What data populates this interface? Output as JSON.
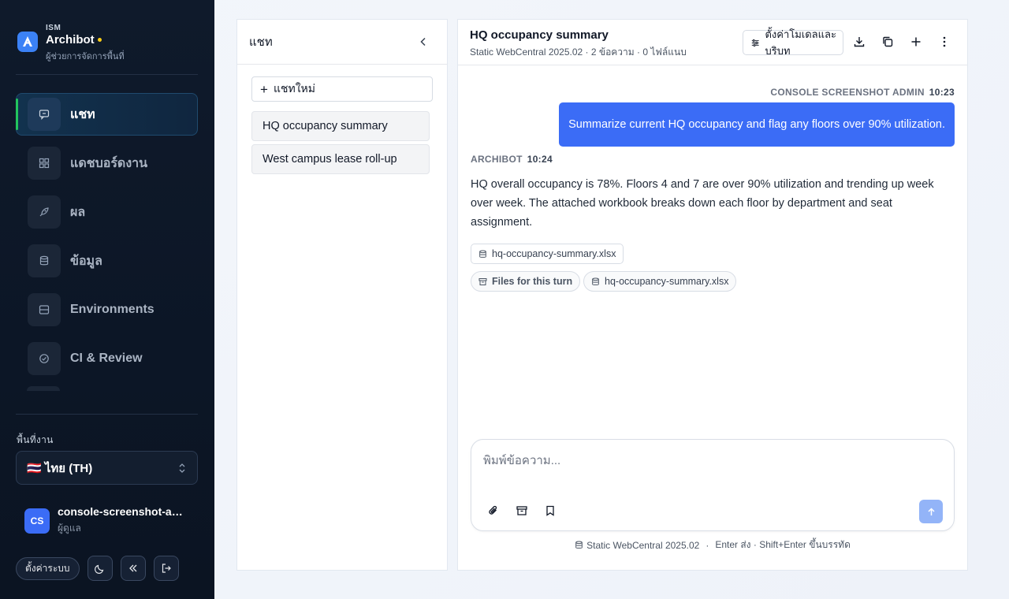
{
  "brand": {
    "small": "ISM",
    "name": "Archibot",
    "subtitle": "ผู้ช่วยการจัดการพื้นที่"
  },
  "sidebar": {
    "items": [
      {
        "label": "แชท",
        "icon": "chat-icon",
        "active": true
      },
      {
        "label": "แดชบอร์ดงาน",
        "icon": "dashboard-icon",
        "active": false
      },
      {
        "label": "ผล",
        "icon": "rocket-icon",
        "active": false
      },
      {
        "label": "ข้อมูล",
        "icon": "database-icon",
        "active": false
      },
      {
        "label": "Environments",
        "icon": "server-icon",
        "active": false
      },
      {
        "label": "CI & Review",
        "icon": "check-circle-icon",
        "active": false
      }
    ],
    "workspace_label": "พื้นที่งาน",
    "workspace_value": "🇹🇭 ไทย (TH)"
  },
  "user": {
    "initials": "CS",
    "name": "console-screenshot-admin",
    "role": "ผู้ดูแล"
  },
  "footer": {
    "settings_label": "ตั้งค่าระบบ"
  },
  "history": {
    "title": "แชท",
    "new_label": "แชทใหม่",
    "conversations": [
      "HQ occupancy summary",
      "West campus lease roll-up"
    ]
  },
  "chat": {
    "title": "HQ occupancy summary",
    "meta": "Static WebCentral 2025.02 · 2 ข้อความ · 0 ไฟล์แนบ",
    "config_label": "ตั้งค่าโมเดลและบริบท",
    "user_message": {
      "author": "CONSOLE SCREENSHOT ADMIN",
      "time": "10:23",
      "text": "Summarize current HQ occupancy and flag any floors over 90% utilization."
    },
    "bot_message": {
      "author": "ARCHIBOT",
      "time": "10:24",
      "text": "HQ overall occupancy is 78%. Floors 4 and 7 are over 90% utilization and trending up week over week. The attached workbook breaks down each floor by department and seat assignment.",
      "attachment": "hq-occupancy-summary.xlsx",
      "files_label": "Files for this turn",
      "files_item": "hq-occupancy-summary.xlsx"
    },
    "composer_placeholder": "พิมพ์ข้อความ...",
    "hint_env": "Static WebCentral 2025.02",
    "hint_keys": "Enter ส่ง · Shift+Enter ขึ้นบรรทัด"
  },
  "colors": {
    "accent": "#3b6cf6",
    "sidebar_bg": "#0f1a2b",
    "active_marker": "#22c55e",
    "brand_dot": "#facc15"
  }
}
